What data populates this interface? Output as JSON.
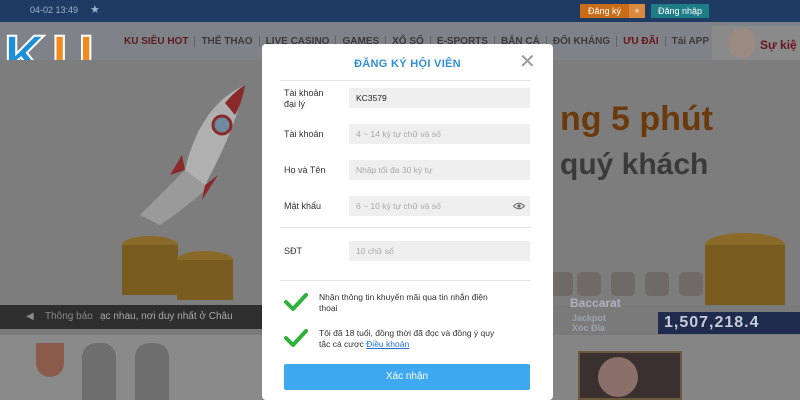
{
  "topbar": {
    "time": "04-02 13:49",
    "register_label": "Đăng ký",
    "register_plus": "+",
    "login_label": "Đăng nhập"
  },
  "nav": {
    "items": [
      "KU SIÊU HOT",
      "THỂ THAO",
      "LIVE CASINO",
      "GAMES",
      "XỔ SỐ",
      "E-SPORTS",
      "BẮN CÁ",
      "ĐỐI KHÁNG",
      "ƯU ĐÃI",
      "Tải APP"
    ],
    "promo_corner": "Sự kiệ"
  },
  "hero": {
    "line1": "ng 5 phút",
    "line2": "quý khách"
  },
  "notice": {
    "label": "Thông báo",
    "message": "ạc nhau, nơi duy nhất ở Châu"
  },
  "jackpot": {
    "game": "Baccarat",
    "label_line1": "Jackpot",
    "label_line2": "Xóc Đĩa",
    "value": "1,507,218.4"
  },
  "modal": {
    "title": "ĐĂNG KÝ HỘI VIÊN",
    "close_icon": "close-icon",
    "fields": {
      "agent": {
        "label_line1": "Tài khoản",
        "label_line2": "đại lý",
        "value": "KC3579",
        "placeholder": ""
      },
      "account": {
        "label": "Tài khoản",
        "value": "",
        "placeholder": "4 ~ 14 ký tự chữ và số"
      },
      "fullname": {
        "label": "Họ và Tên",
        "value": "",
        "placeholder": "Nhập tối đa 30 ký tự"
      },
      "password": {
        "label": "Mật khẩu",
        "value": "",
        "placeholder": "6 ~ 10 ký tự chữ và số"
      },
      "phone": {
        "label": "SĐT",
        "value": "",
        "placeholder": "10 chữ số"
      }
    },
    "checkbox_promo": {
      "checked": true,
      "text_line1": "Nhận thông tin khuyến mãi qua tin nhắn điện",
      "text_line2": "thoại"
    },
    "checkbox_terms": {
      "checked": true,
      "text_line1": "Tôi đã 18 tuổi, đồng thời đã đọc và đồng ý quy",
      "text_line2_prefix": "tắc cá cược",
      "terms_link": "Điều khoản"
    },
    "submit_label": "Xác nhận"
  },
  "colors": {
    "accent": "#2f8fd8",
    "button": "#3ea8f0",
    "check": "#2fb13b",
    "overlay": "#7a7a7a"
  }
}
